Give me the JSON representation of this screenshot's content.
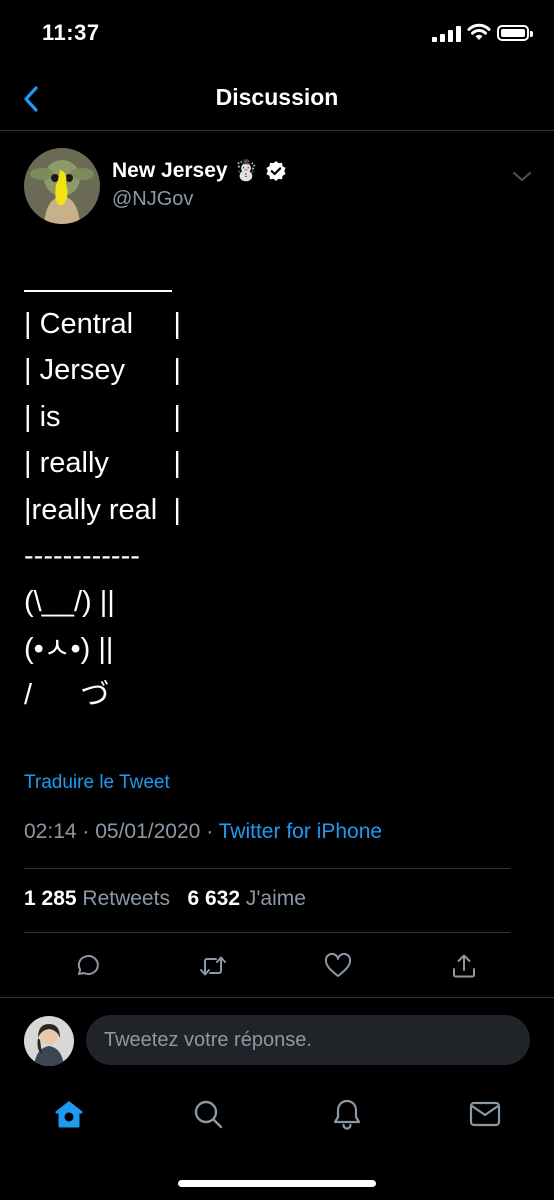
{
  "status_bar": {
    "time": "11:37"
  },
  "nav": {
    "title": "Discussion",
    "back_icon": "chevron-left-icon"
  },
  "tweet": {
    "author_name": "New Jersey",
    "author_emoji": "☃️",
    "handle": "@NJGov",
    "text_lines": [
      "| Central     |",
      "| Jersey      |",
      "| is              |",
      "| really        |",
      "|really real  |",
      "------------",
      "(\\__/) ||",
      "(•ㅅ•) ||",
      "/      づ"
    ],
    "translate_label": "Traduire le Tweet",
    "time": "02:14",
    "date": "05/01/2020",
    "source": "Twitter for iPhone",
    "retweets_count": "1 285",
    "retweets_label": "Retweets",
    "likes_count": "6 632",
    "likes_label": "J'aime"
  },
  "reply": {
    "placeholder": "Tweetez votre réponse."
  },
  "colors": {
    "accent": "#1d9bf0",
    "muted": "#8b98a5",
    "background": "#000000",
    "divider": "#2f3336"
  }
}
